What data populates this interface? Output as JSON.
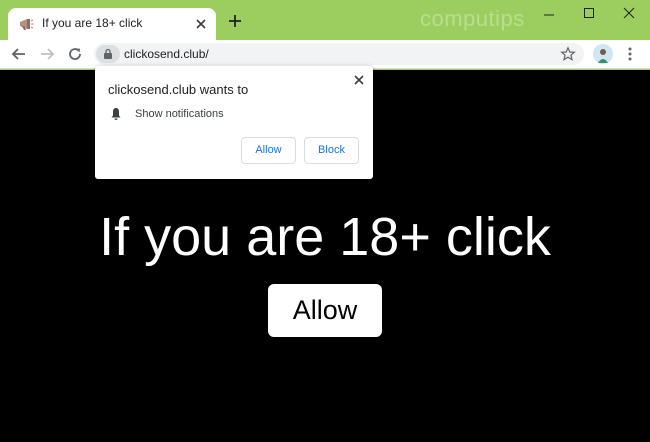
{
  "tab": {
    "title": "If you are 18+ click",
    "favicon": "megaphone-favicon-icon",
    "close_icon": "close-icon"
  },
  "watermark": "computips",
  "toolbar": {
    "url": "clickosend.club/",
    "icons": [
      "back-arrow-icon",
      "forward-arrow-icon",
      "reload-icon",
      "lock-icon",
      "star-icon",
      "avatar",
      "menu-dots-icon"
    ]
  },
  "popup": {
    "title": "clickosend.club wants to",
    "permission": "Show notifications",
    "allow_label": "Allow",
    "block_label": "Block"
  },
  "page": {
    "headline": "If you are 18+ click",
    "button_label": "Allow"
  },
  "colors": {
    "frame": "#9ccd5f",
    "page_background": "#000000",
    "popup_button_text": "#1a73e8"
  }
}
